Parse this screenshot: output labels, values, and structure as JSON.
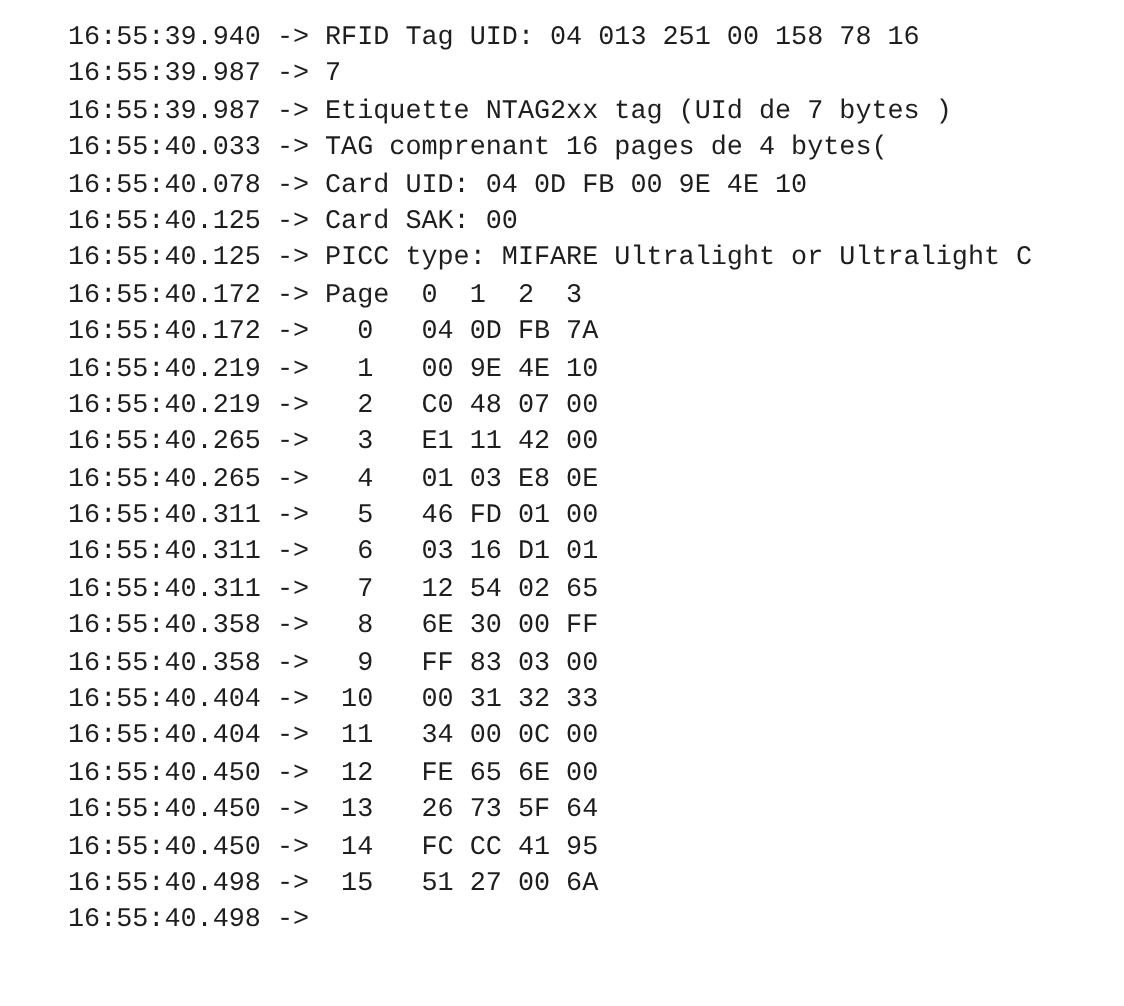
{
  "log": [
    {
      "time": "16:55:39.940",
      "arrow": "->",
      "message": "RFID Tag UID: 04 013 251 00 158 78 16"
    },
    {
      "time": "16:55:39.987",
      "arrow": "->",
      "message": "7"
    },
    {
      "time": "16:55:39.987",
      "arrow": "->",
      "message": "Etiquette NTAG2xx tag (UId de 7 bytes )"
    },
    {
      "time": "16:55:40.033",
      "arrow": "->",
      "message": "TAG comprenant 16 pages de 4 bytes("
    },
    {
      "time": "16:55:40.078",
      "arrow": "->",
      "message": "Card UID: 04 0D FB 00 9E 4E 10"
    },
    {
      "time": "16:55:40.125",
      "arrow": "->",
      "message": "Card SAK: 00"
    },
    {
      "time": "16:55:40.125",
      "arrow": "->",
      "message": "PICC type: MIFARE Ultralight or Ultralight C"
    },
    {
      "time": "16:55:40.172",
      "arrow": "->",
      "message": "Page  0  1  2  3"
    },
    {
      "time": "16:55:40.172",
      "arrow": "->",
      "message": "  0   04 0D FB 7A"
    },
    {
      "time": "16:55:40.219",
      "arrow": "->",
      "message": "  1   00 9E 4E 10"
    },
    {
      "time": "16:55:40.219",
      "arrow": "->",
      "message": "  2   C0 48 07 00"
    },
    {
      "time": "16:55:40.265",
      "arrow": "->",
      "message": "  3   E1 11 42 00"
    },
    {
      "time": "16:55:40.265",
      "arrow": "->",
      "message": "  4   01 03 E8 0E"
    },
    {
      "time": "16:55:40.311",
      "arrow": "->",
      "message": "  5   46 FD 01 00"
    },
    {
      "time": "16:55:40.311",
      "arrow": "->",
      "message": "  6   03 16 D1 01"
    },
    {
      "time": "16:55:40.311",
      "arrow": "->",
      "message": "  7   12 54 02 65"
    },
    {
      "time": "16:55:40.358",
      "arrow": "->",
      "message": "  8   6E 30 00 FF"
    },
    {
      "time": "16:55:40.358",
      "arrow": "->",
      "message": "  9   FF 83 03 00"
    },
    {
      "time": "16:55:40.404",
      "arrow": "->",
      "message": " 10   00 31 32 33"
    },
    {
      "time": "16:55:40.404",
      "arrow": "->",
      "message": " 11   34 00 0C 00"
    },
    {
      "time": "16:55:40.450",
      "arrow": "->",
      "message": " 12   FE 65 6E 00"
    },
    {
      "time": "16:55:40.450",
      "arrow": "->",
      "message": " 13   26 73 5F 64"
    },
    {
      "time": "16:55:40.450",
      "arrow": "->",
      "message": " 14   FC CC 41 95"
    },
    {
      "time": "16:55:40.498",
      "arrow": "->",
      "message": " 15   51 27 00 6A"
    },
    {
      "time": "16:55:40.498",
      "arrow": "->"
    }
  ]
}
